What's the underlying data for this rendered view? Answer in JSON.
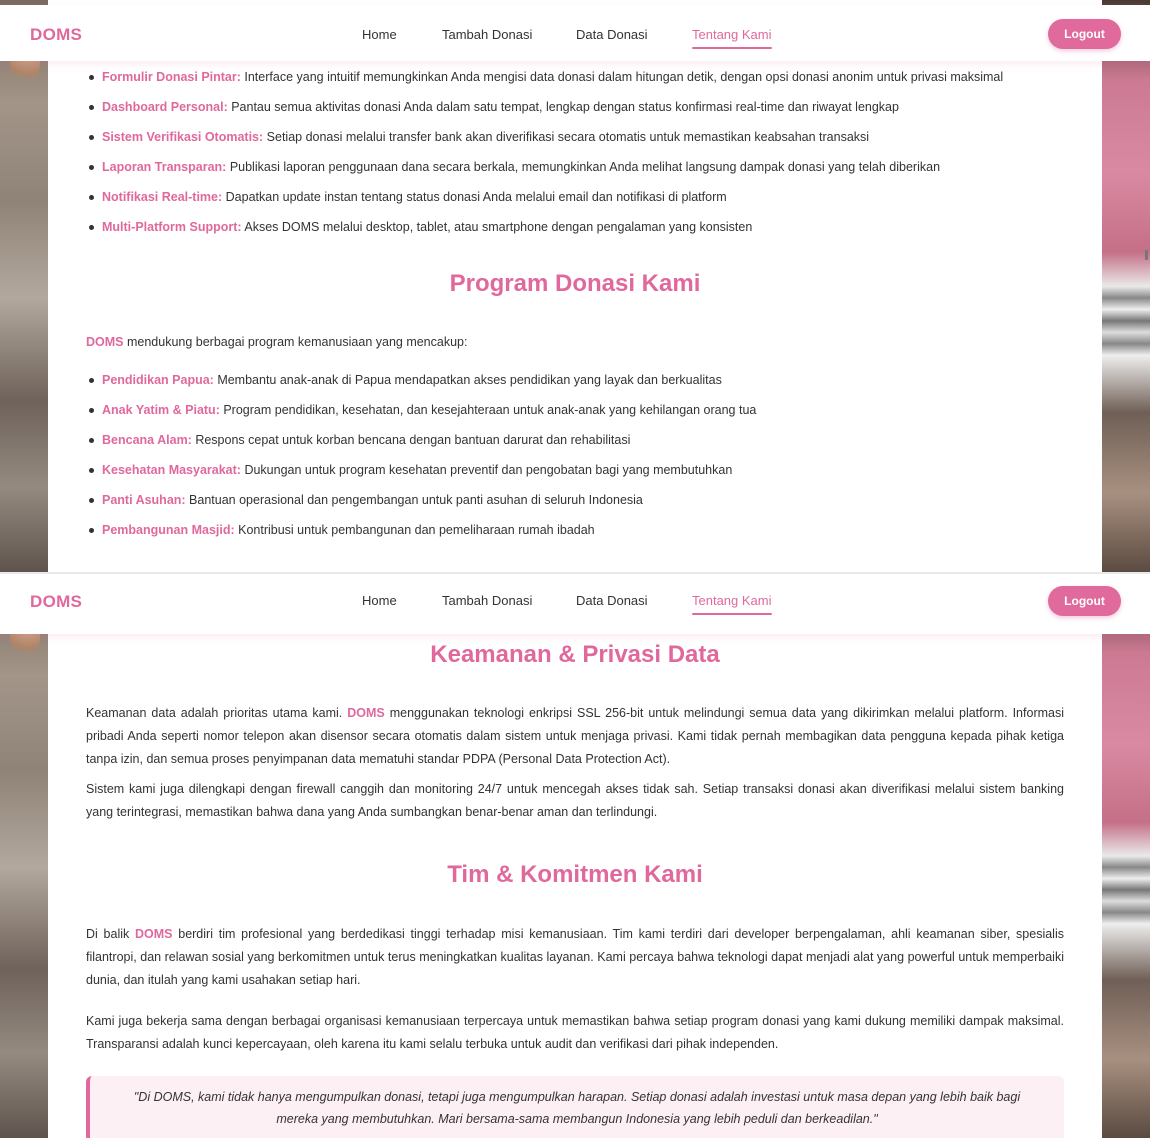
{
  "navbar": {
    "logo": "DOMS",
    "links": [
      "Home",
      "Tambah Donasi",
      "Data Donasi",
      "Tentang Kami"
    ],
    "active_link": "Tentang Kami",
    "logout_label": "Logout"
  },
  "features": [
    {
      "title": "Formulir Donasi Pintar:",
      "text": " Interface yang intuitif memungkinkan Anda mengisi data donasi dalam hitungan detik, dengan opsi donasi anonim untuk privasi maksimal"
    },
    {
      "title": "Dashboard Personal:",
      "text": " Pantau semua aktivitas donasi Anda dalam satu tempat, lengkap dengan status konfirmasi real-time dan riwayat lengkap"
    },
    {
      "title": "Sistem Verifikasi Otomatis:",
      "text": " Setiap donasi melalui transfer bank akan diverifikasi secara otomatis untuk memastikan keabsahan transaksi"
    },
    {
      "title": "Laporan Transparan:",
      "text": " Publikasi laporan penggunaan dana secara berkala, memungkinkan Anda melihat langsung dampak donasi yang telah diberikan"
    },
    {
      "title": "Notifikasi Real-time:",
      "text": " Dapatkan update instan tentang status donasi Anda melalui email dan notifikasi di platform"
    },
    {
      "title": "Multi-Platform Support:",
      "text": " Akses DOMS melalui desktop, tablet, atau smartphone dengan pengalaman yang konsisten"
    }
  ],
  "programs": {
    "title": "Program Donasi Kami",
    "intro_brand": "DOMS",
    "intro_text": " mendukung berbagai program kemanusiaan yang mencakup:",
    "items": [
      {
        "title": "Pendidikan Papua:",
        "text": " Membantu anak-anak di Papua mendapatkan akses pendidikan yang layak dan berkualitas"
      },
      {
        "title": "Anak Yatim & Piatu:",
        "text": " Program pendidikan, kesehatan, dan kesejahteraan untuk anak-anak yang kehilangan orang tua"
      },
      {
        "title": "Bencana Alam:",
        "text": " Respons cepat untuk korban bencana dengan bantuan darurat dan rehabilitasi"
      },
      {
        "title": "Kesehatan Masyarakat:",
        "text": " Dukungan untuk program kesehatan preventif dan pengobatan bagi yang membutuhkan"
      },
      {
        "title": "Panti Asuhan:",
        "text": " Bantuan operasional dan pengembangan untuk panti asuhan di seluruh Indonesia"
      },
      {
        "title": "Pembangunan Masjid:",
        "text": " Kontribusi untuk pembangunan dan pemeliharaan rumah ibadah"
      }
    ]
  },
  "security": {
    "title": "Keamanan & Privasi Data",
    "p1_a": "Keamanan data adalah prioritas utama kami. ",
    "p1_brand": "DOMS",
    "p1_b": " menggunakan teknologi enkripsi SSL 256-bit untuk melindungi semua data yang dikirimkan melalui platform. Informasi pribadi Anda seperti nomor telepon akan disensor secara otomatis dalam sistem untuk menjaga privasi. Kami tidak pernah membagikan data pengguna kepada pihak ketiga tanpa izin, dan semua proses penyimpanan data mematuhi standar PDPA (Personal Data Protection Act).",
    "p2": "Sistem kami juga dilengkapi dengan firewall canggih dan monitoring 24/7 untuk mencegah akses tidak sah. Setiap transaksi donasi akan diverifikasi melalui sistem banking yang terintegrasi, memastikan bahwa dana yang Anda sumbangkan benar-benar aman dan terlindungi."
  },
  "team": {
    "title": "Tim & Komitmen Kami",
    "p1_a": "Di balik ",
    "p1_brand": "DOMS",
    "p1_b": " berdiri tim profesional yang berdedikasi tinggi terhadap misi kemanusiaan. Tim kami terdiri dari developer berpengalaman, ahli keamanan siber, spesialis filantropi, dan relawan sosial yang berkomitmen untuk terus meningkatkan kualitas layanan. Kami percaya bahwa teknologi dapat menjadi alat yang powerful untuk memperbaiki dunia, dan itulah yang kami usahakan setiap hari.",
    "p2": "Kami juga bekerja sama dengan berbagai organisasi kemanusiaan terpercaya untuk memastikan bahwa setiap program donasi yang kami dukung memiliki dampak maksimal. Transparansi adalah kunci kepercayaan, oleh karena itu kami selalu terbuka untuk audit dan verifikasi dari pihak independen.",
    "quote": "\"Di DOMS, kami tidak hanya mengumpulkan donasi, tetapi juga mengumpulkan harapan. Setiap donasi adalah investasi untuk masa depan yang lebih baik bagi mereka yang membutuhkan. Mari bersama-sama membangun Indonesia yang lebih peduli dan berkeadilan.\""
  },
  "colors": {
    "accent": "#e0689c",
    "quote_bg": "#fdf0f4"
  }
}
